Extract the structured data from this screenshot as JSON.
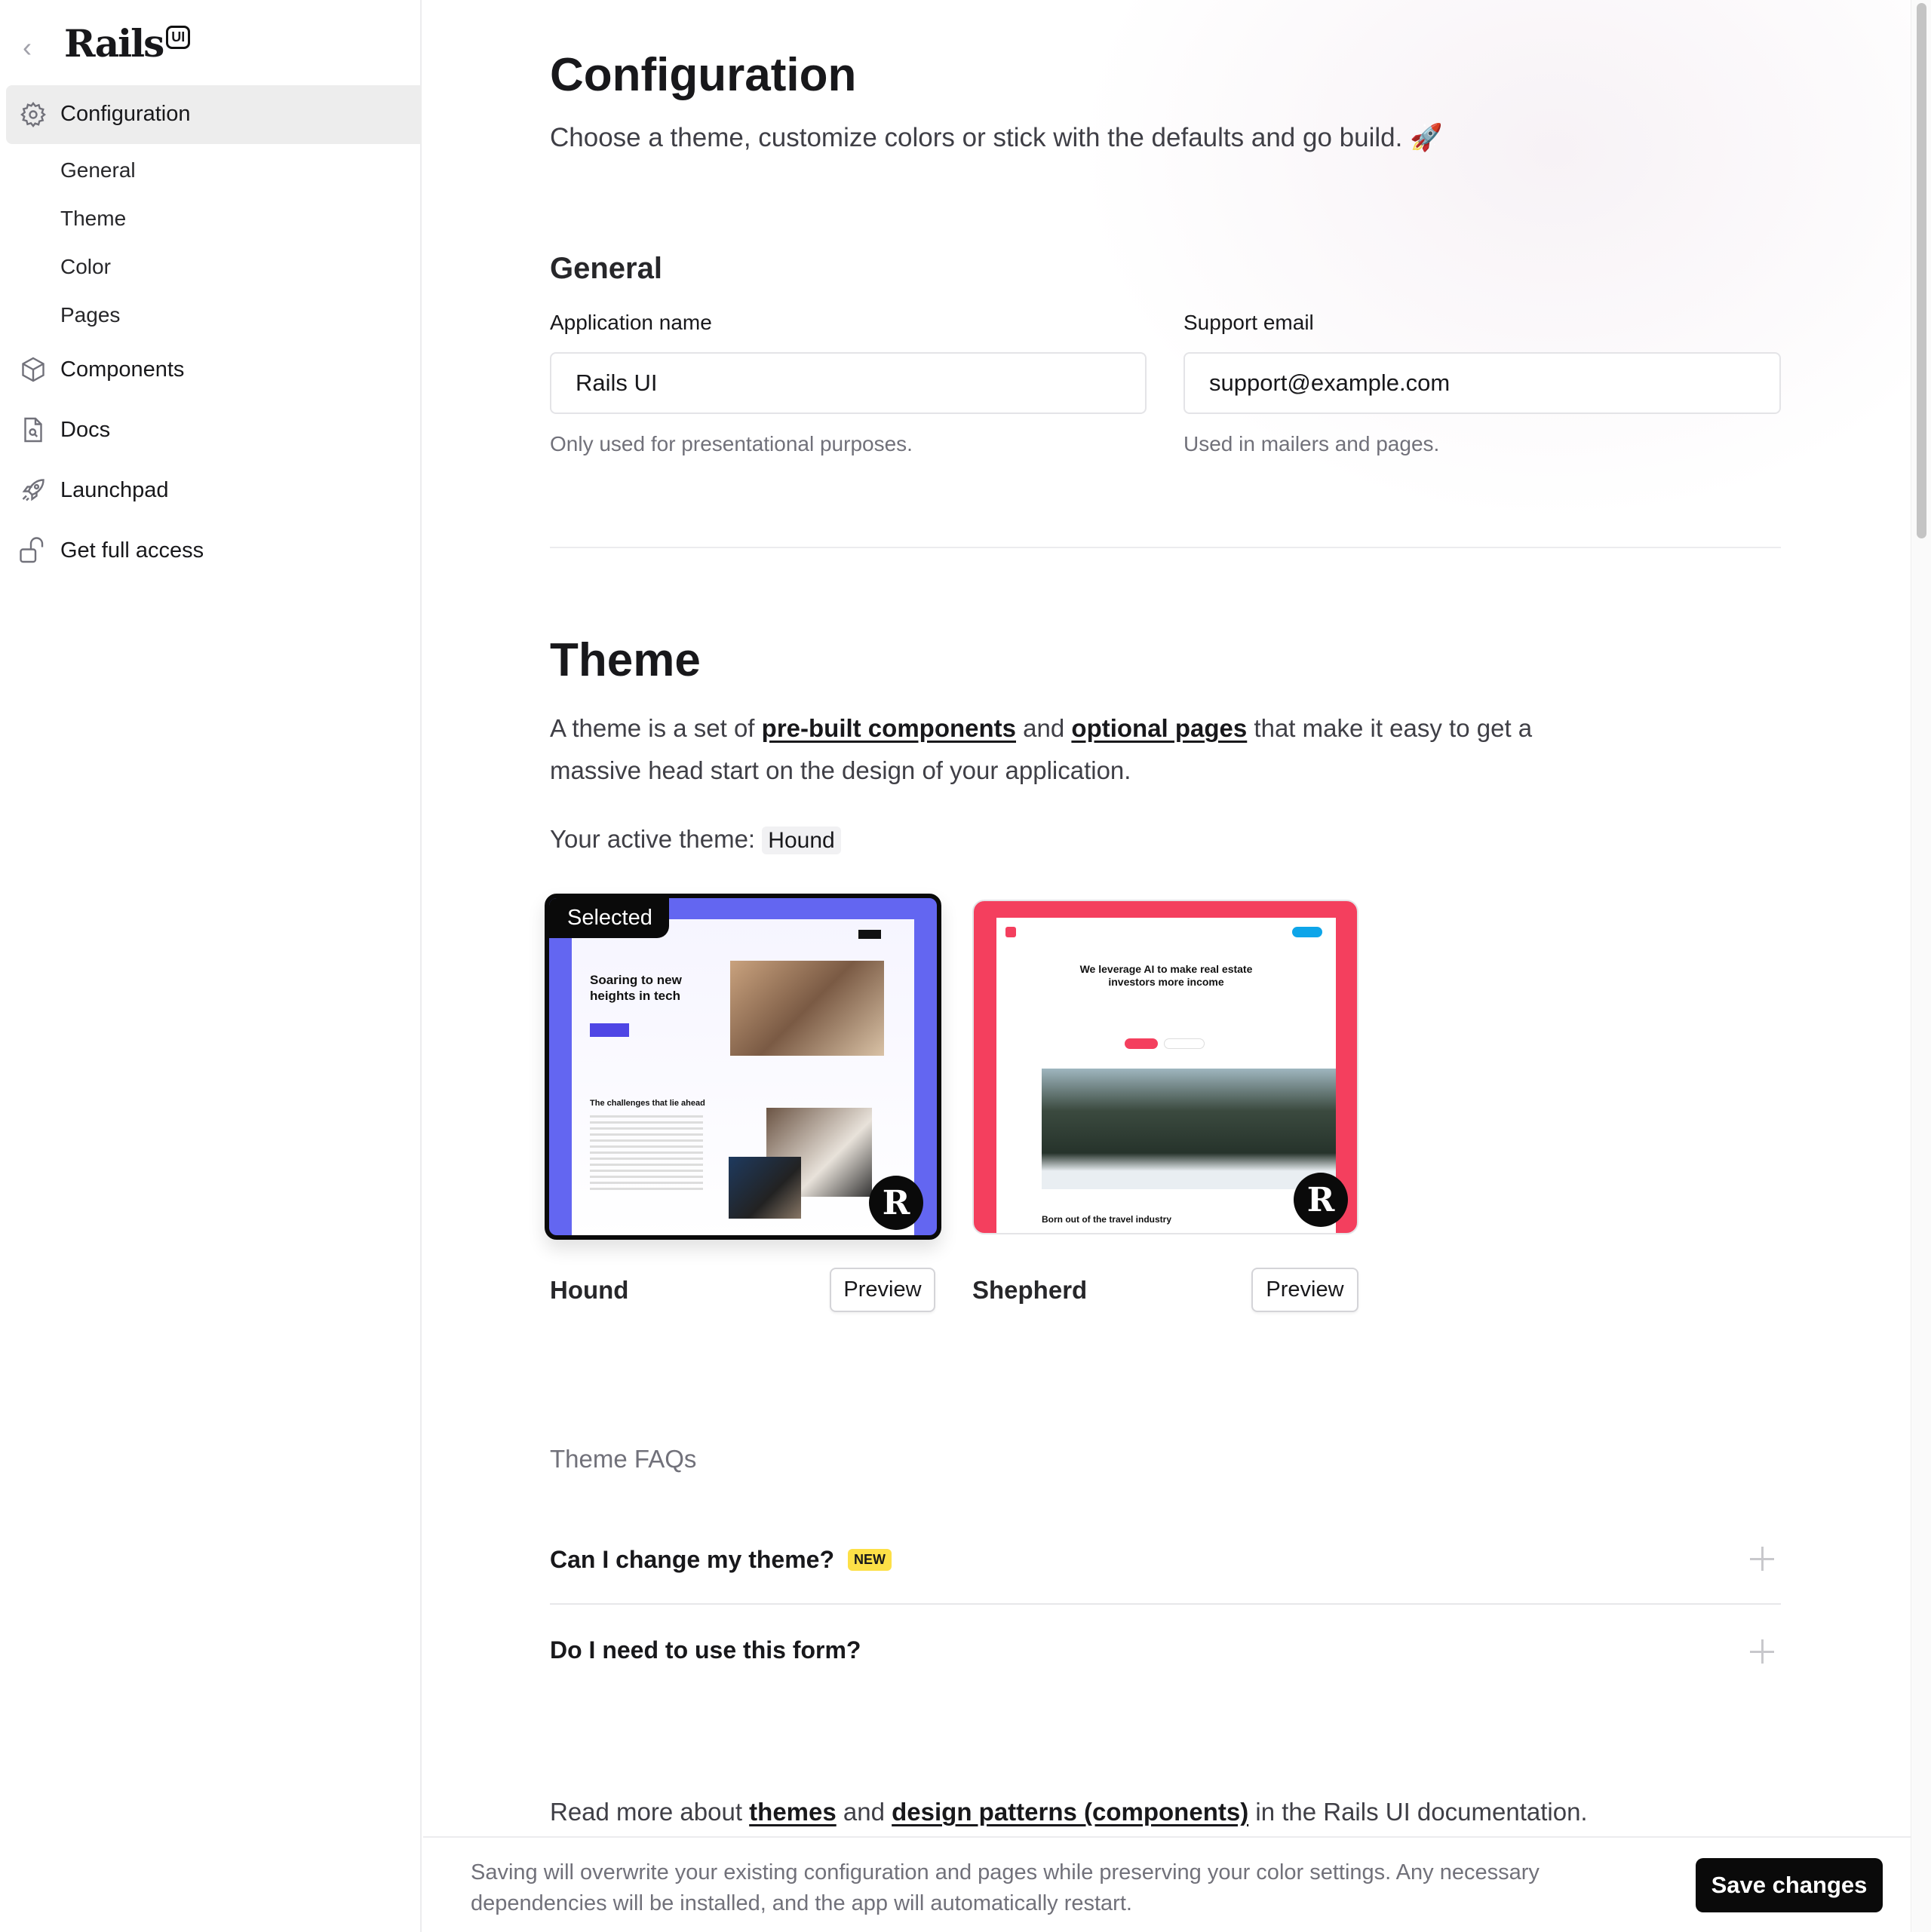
{
  "sidebar": {
    "logo_text": "Rails",
    "logo_badge": "UI",
    "items": [
      {
        "label": "Configuration",
        "icon": "gear-icon",
        "active": true,
        "children": [
          {
            "label": "General"
          },
          {
            "label": "Theme"
          },
          {
            "label": "Color"
          },
          {
            "label": "Pages"
          }
        ]
      },
      {
        "label": "Components",
        "icon": "cube-icon"
      },
      {
        "label": "Docs",
        "icon": "document-search-icon"
      },
      {
        "label": "Launchpad",
        "icon": "rocket-icon"
      },
      {
        "label": "Get full access",
        "icon": "unlock-icon"
      }
    ]
  },
  "header": {
    "title": "Configuration",
    "subtitle": "Choose a theme, customize colors or stick with the defaults and go build. 🚀"
  },
  "general": {
    "title": "General",
    "app_name": {
      "label": "Application name",
      "value": "Rails UI",
      "help": "Only used for presentational purposes."
    },
    "support_email": {
      "label": "Support email",
      "value": "support@example.com",
      "help": "Used in mailers and pages."
    }
  },
  "theme": {
    "title": "Theme",
    "desc_before": "A theme is a set of ",
    "link1": "pre-built components",
    "desc_mid": " and ",
    "link2": "optional pages",
    "desc_after": " that make it easy to get a massive head start on the design of your application.",
    "active_label": "Your active theme:",
    "active_value": "Hound",
    "cards": [
      {
        "name": "Hound",
        "selected_label": "Selected",
        "preview": "Preview",
        "color": "#6366f1",
        "headline": "Soaring to new heights in tech",
        "section": "The challenges that lie ahead"
      },
      {
        "name": "Shepherd",
        "preview": "Preview",
        "color": "#f43f5e",
        "headline": "We leverage AI to make real estate investors more income",
        "section": "Born out of the travel industry"
      }
    ]
  },
  "faqs": {
    "title": "Theme FAQs",
    "items": [
      {
        "question": "Can I change my theme?",
        "badge": "NEW"
      },
      {
        "question": "Do I need to use this form?"
      }
    ]
  },
  "read_more": {
    "before": "Read more about ",
    "link1": "themes",
    "mid": " and ",
    "link2": "design patterns (components)",
    "after": " in the Rails UI documentation."
  },
  "footer": {
    "notice": "Saving will overwrite your existing configuration and pages while preserving your color settings. Any necessary dependencies will be installed, and the app will automatically restart.",
    "save_label": "Save changes"
  },
  "colors": {
    "accent": "#0a0a0a",
    "hound": "#6366f1",
    "shepherd": "#f43f5e",
    "badge": "#fde047"
  }
}
